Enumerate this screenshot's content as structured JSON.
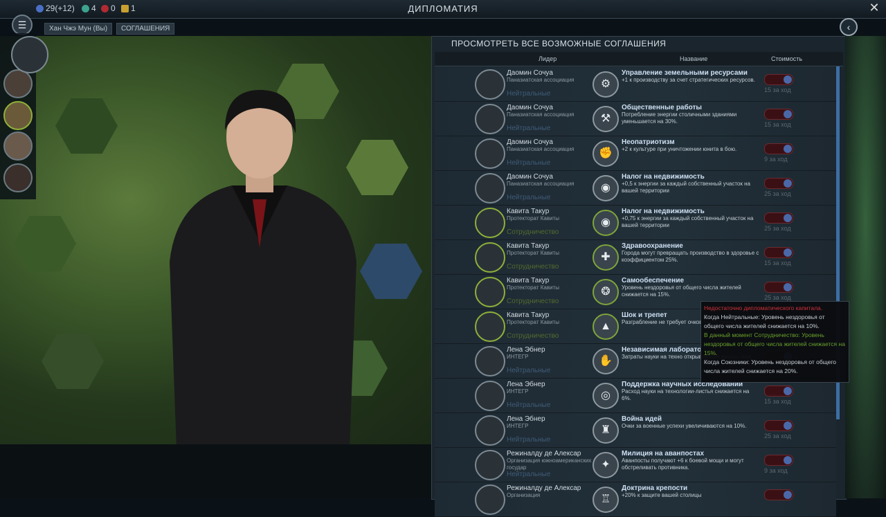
{
  "topbar": {
    "science": "29(+12)",
    "culture": "4",
    "health": "0",
    "energy": "1",
    "title": "ДИПЛОМАТИЯ"
  },
  "breadcrumbs": [
    "Хан Чжэ Мун (Вы)",
    "СОГЛАШЕНИЯ"
  ],
  "panel": {
    "title": "ПРОСМОТРЕТЬ ВСЕ ВОЗМОЖНЫЕ СОГЛАШЕНИЯ",
    "columns": [
      "Лидер",
      "Название",
      "Стоимость"
    ]
  },
  "rows": [
    {
      "leader": "Даомин Сочуа",
      "org": "Паназиатская ассоциация",
      "status": "Нейтральные",
      "name": "Управление земельными ресурсами",
      "desc": "+1 к производству за счет стратегических ресурсов.",
      "turns": "15 за ход"
    },
    {
      "leader": "Даомин Сочуа",
      "org": "Паназиатская ассоциация",
      "status": "Нейтральные",
      "name": "Общественные работы",
      "desc": "Потребление энергии столичными зданиями уменьшается на 30%.",
      "turns": "15 за ход"
    },
    {
      "leader": "Даомин Сочуа",
      "org": "Паназиатская ассоциация",
      "status": "Нейтральные",
      "name": "Неопатриотизм",
      "desc": "+2 к культуре при уничтожении юнита в бою.",
      "turns": "9 за ход"
    },
    {
      "leader": "Даомин Сочуа",
      "org": "Паназиатская ассоциация",
      "status": "Нейтральные",
      "name": "Налог на недвижимость",
      "desc": "+0,5 к энергии за каждый собственный участок на вашей территории",
      "turns": "25 за ход"
    },
    {
      "leader": "Кавита Такур",
      "org": "Протекторат Кавиты",
      "status": "Сотрудничество",
      "name": "Налог на недвижимость",
      "desc": "+0,75 к энергии за каждый собственный участок на вашей территории",
      "turns": "25 за ход"
    },
    {
      "leader": "Кавита Такур",
      "org": "Протекторат Кавиты",
      "status": "Сотрудничество",
      "name": "Здравоохранение",
      "desc": "Города могут превращать производство в здоровье с коэффициентом 25%.",
      "turns": "15 за ход"
    },
    {
      "leader": "Кавита Такур",
      "org": "Протекторат Кавиты",
      "status": "Сотрудничество",
      "name": "Самообеспечение",
      "desc": "Уровень нездоровья от общего числа жителей снижается на 15%.",
      "turns": "25 за ход"
    },
    {
      "leader": "Кавита Такур",
      "org": "Протекторат Кавиты",
      "status": "Сотрудничество",
      "name": "Шок и трепет",
      "desc": "Разграбление не требует очков передвижения.",
      "turns": ""
    },
    {
      "leader": "Лена Эбнер",
      "org": "ИНТЕГР",
      "status": "Нейтральные",
      "name": "Независимая лаборато",
      "desc": "Затраты науки на техно открывающие юниты, ниж",
      "turns": ""
    },
    {
      "leader": "Лена Эбнер",
      "org": "ИНТЕГР",
      "status": "Нейтральные",
      "name": "Поддержка научных исследований",
      "desc": "Расход науки на технологии-листья снижается на 6%.",
      "turns": "15 за ход"
    },
    {
      "leader": "Лена Эбнер",
      "org": "ИНТЕГР",
      "status": "Нейтральные",
      "name": "Война идей",
      "desc": "Очки за военные успехи увеличиваются на 10%.",
      "turns": "25 за ход"
    },
    {
      "leader": "Режиналду де Алексар",
      "org": "Организация южноамериканских государ",
      "status": "Нейтральные",
      "name": "Милиция на аванпостах",
      "desc": "Аванпосты получают +6 к боевой мощи и могут обстреливать противника.",
      "turns": "9 за ход"
    },
    {
      "leader": "Режиналду де Алексар",
      "org": "Организация",
      "status": "",
      "name": "Доктрина крепости",
      "desc": "+20% к защите вашей столицы",
      "turns": ""
    }
  ],
  "tooltip": {
    "line1": "Недостаточно дипломатического капитала.",
    "line2": "Когда Нейтральные: Уровень нездоровья от общего числа жителей снижается на 10%.",
    "line3": "В данный момент Сотрудничество: Уровень нездоровья от общего числа жителей снижается на 15%.",
    "line4": "Когда Союзники: Уровень нездоровья от общего числа жителей снижается на 20%."
  },
  "colors": {
    "accent": "#3c6ea3",
    "cooperation": "#8fb03a",
    "neutral": "#3f5c78",
    "warning": "#d0323a"
  }
}
